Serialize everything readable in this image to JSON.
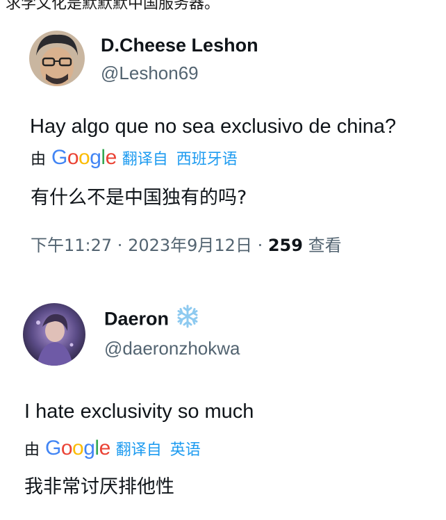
{
  "top_text": "求学文化是默默默中国服务器。",
  "tweets": [
    {
      "author_name": "D.Cheese Leshon",
      "handle": "@Leshon69",
      "text": "Hay algo que no sea exclusivo de china?",
      "translate": {
        "by": "由",
        "provider": "Google",
        "from_label": "翻译自",
        "language": "西班牙语"
      },
      "translated_text": "有什么不是中国独有的吗?",
      "meta": {
        "time": "下午11:27",
        "separator": " · ",
        "date": "2023年9月12日",
        "views": "259",
        "views_label": "查看"
      }
    },
    {
      "author_name": "Daeron",
      "handle": "@daeronzhokwa",
      "badge_icon": "snowflake-icon",
      "text": "I hate exclusivity so much",
      "translate": {
        "by": "由",
        "provider": "Google",
        "from_label": "翻译自",
        "language": "英语"
      },
      "translated_text": "我非常讨厌排他性"
    }
  ],
  "colors": {
    "link": "#1d9bf0",
    "secondary": "#536471",
    "primary": "#0f1419"
  }
}
